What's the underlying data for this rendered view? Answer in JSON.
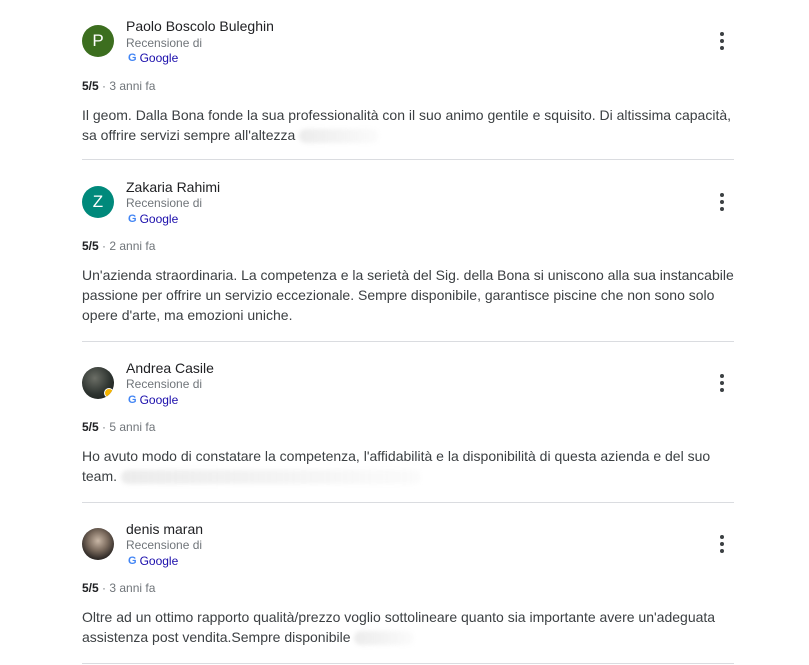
{
  "reviews": [
    {
      "avatar_letter": "P",
      "avatar_color": "#3c6e1f",
      "author": "Paolo Boscolo Buleghin",
      "subtitle": "Recensione di",
      "source": "Google",
      "score": "5/5",
      "time": "· 3 anni fa",
      "text": "Il geom. Dalla Bona fonde la sua professionalità con il suo animo gentile e squisito. Di altissima capacità, sa offrire servizi sempre all'altezza"
    },
    {
      "avatar_letter": "Z",
      "avatar_color": "#00897b",
      "author": "Zakaria Rahimi",
      "subtitle": "Recensione di",
      "source": "Google",
      "score": "5/5",
      "time": "· 2 anni fa",
      "text": "Un'azienda straordinaria. La competenza e la serietà del Sig. della Bona si uniscono alla sua instancabile passione per offrire un servizio eccezionale. Sempre disponibile, garantisce piscine che non sono solo opere d'arte, ma emozioni uniche."
    },
    {
      "author": "Andrea Casile",
      "subtitle": "Recensione di",
      "source": "Google",
      "score": "5/5",
      "time": "· 5 anni fa",
      "text": "Ho avuto modo di constatare la competenza, l'affidabilità e la disponibilità di questa azienda e del suo team."
    },
    {
      "author": "denis maran",
      "subtitle": "Recensione di",
      "source": "Google",
      "score": "5/5",
      "time": "· 3 anni fa",
      "text": "Oltre ad un ottimo rapporto qualità/prezzo voglio sottolineare quanto sia importante avere un'adeguata assistenza post vendita.Sempre disponibile"
    }
  ],
  "icons": {
    "more": "more-vert-icon",
    "google": "google-g-icon"
  },
  "colors": {
    "link": "#1a0dab",
    "meta": "#70757a",
    "divider": "#dadce0"
  }
}
